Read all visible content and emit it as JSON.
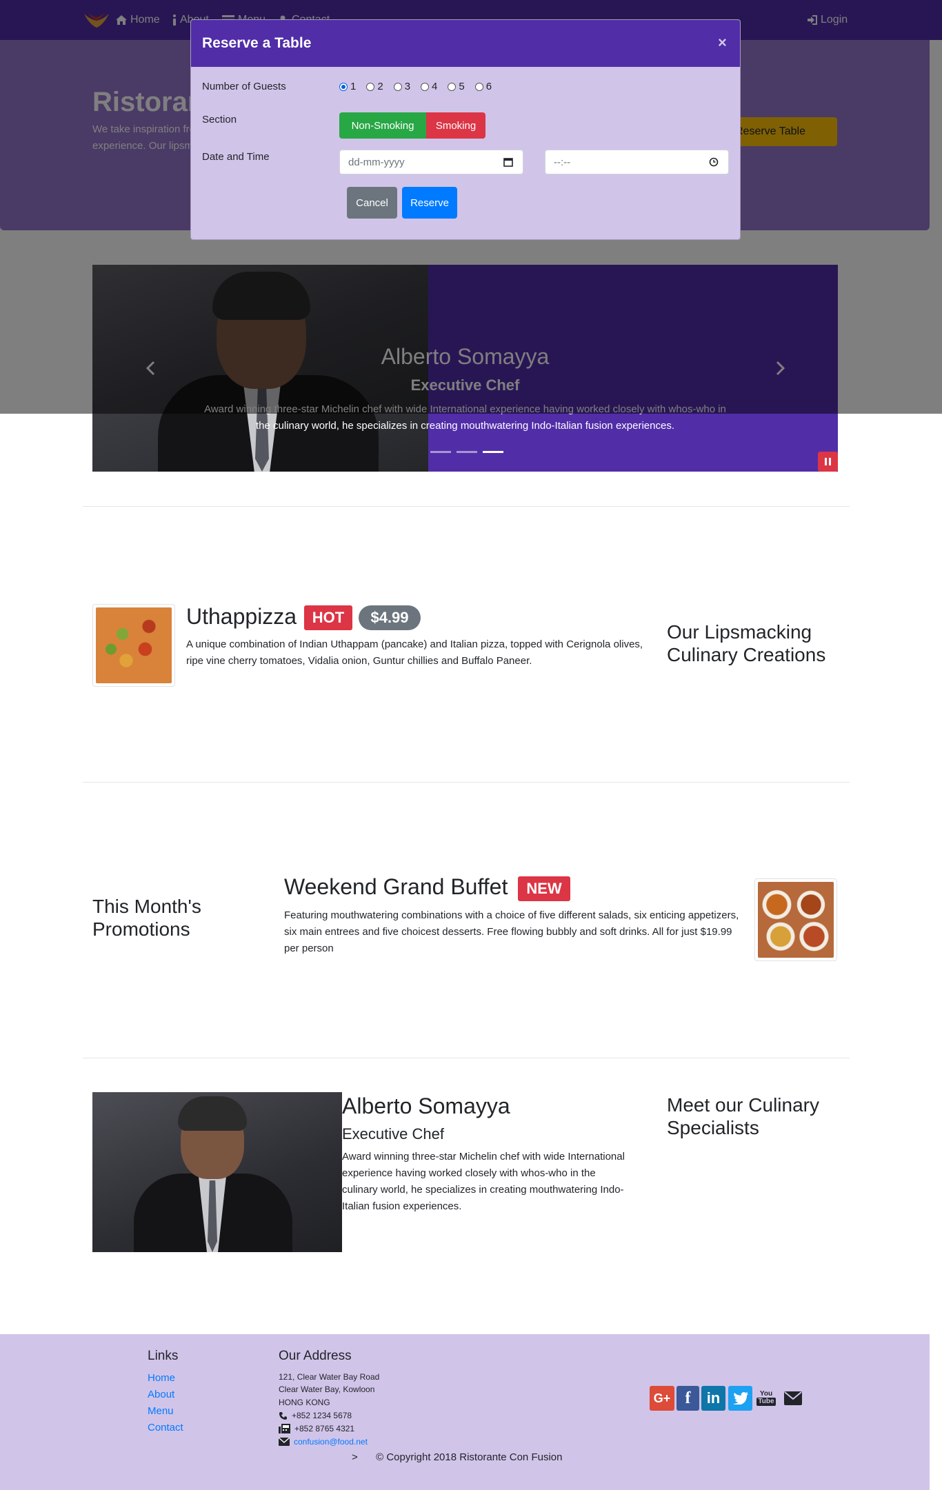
{
  "nav": {
    "items": [
      {
        "label": "Home",
        "icon": "home-icon"
      },
      {
        "label": "About",
        "icon": "info-icon"
      },
      {
        "label": "Menu",
        "icon": "list-icon"
      },
      {
        "label": "Contact",
        "icon": "address-card-icon"
      }
    ],
    "login_label": "Login"
  },
  "jumbotron": {
    "title": "Ristorante Con Fusion",
    "text": "We take inspiration from the World's best cuisines, and create a unique fusion experience. Our lipsmacking creations will tickle your culinary senses!",
    "button_label": "Reserve Table"
  },
  "carousel": {
    "title": "Alberto Somayya",
    "subtitle": "Executive Chef",
    "text": "Award winning three-star Michelin chef with wide International experience having worked closely with whos-who in the culinary world, he specializes in creating mouthwatering Indo-Italian fusion experiences.",
    "slide_count": 3,
    "active_slide": 3
  },
  "modal": {
    "title": "Reserve a Table",
    "close_glyph": "×",
    "guests_label": "Number of Guests",
    "guest_options": [
      "1",
      "2",
      "3",
      "4",
      "5",
      "6"
    ],
    "guest_selected": "1",
    "section_label": "Section",
    "section_options": [
      "Non-Smoking",
      "Smoking"
    ],
    "datetime_label": "Date and Time",
    "date_placeholder": "dd-mm-yyyy",
    "time_placeholder": "--:--",
    "cancel_label": "Cancel",
    "reserve_label": "Reserve"
  },
  "dish": {
    "name": "Uthappizza",
    "badge": "HOT",
    "price": "$4.99",
    "description": "A unique combination of Indian Uthappam (pancake) and Italian pizza, topped with Cerignola olives, ripe vine cherry tomatoes, Vidalia onion, Guntur chillies and Buffalo Paneer.",
    "side_heading": "Our Lipsmacking Culinary Creations"
  },
  "promotion": {
    "name": "Weekend Grand Buffet",
    "badge": "NEW",
    "description": "Featuring mouthwatering combinations with a choice of five different salads, six enticing appetizers, six main entrees and five choicest desserts. Free flowing bubbly and soft drinks. All for just $19.99 per person",
    "side_heading": "This Month's Promotions"
  },
  "leader": {
    "name": "Alberto Somayya",
    "designation": "Executive Chef",
    "description": "Award winning three-star Michelin chef with wide International experience having worked closely with whos-who in the culinary world, he specializes in creating mouthwatering Indo-Italian fusion experiences.",
    "side_heading": "Meet our Culinary Specialists"
  },
  "footer": {
    "links_heading": "Links",
    "links": [
      "Home",
      "About",
      "Menu",
      "Contact"
    ],
    "address_heading": "Our Address",
    "address_lines": [
      "121, Clear Water Bay Road",
      "Clear Water Bay, Kowloon",
      "HONG KONG"
    ],
    "phone": "+852 1234 5678",
    "fax": "+852 8765 4321",
    "email": "confusion@food.net",
    "social": [
      "google-plus-icon",
      "facebook-icon",
      "linkedin-icon",
      "twitter-icon",
      "youtube-icon",
      "envelope-icon"
    ],
    "copyright_prefix": ">",
    "copyright": "© Copyright 2018 Ristorante Con Fusion"
  },
  "colors": {
    "primary": "#512da8",
    "light": "#9575cd",
    "lightest": "#d1c4e9",
    "warning": "#ffc107",
    "success": "#28a745",
    "danger": "#dc3545",
    "info_blue": "#007bff",
    "secondary": "#6c757d"
  }
}
